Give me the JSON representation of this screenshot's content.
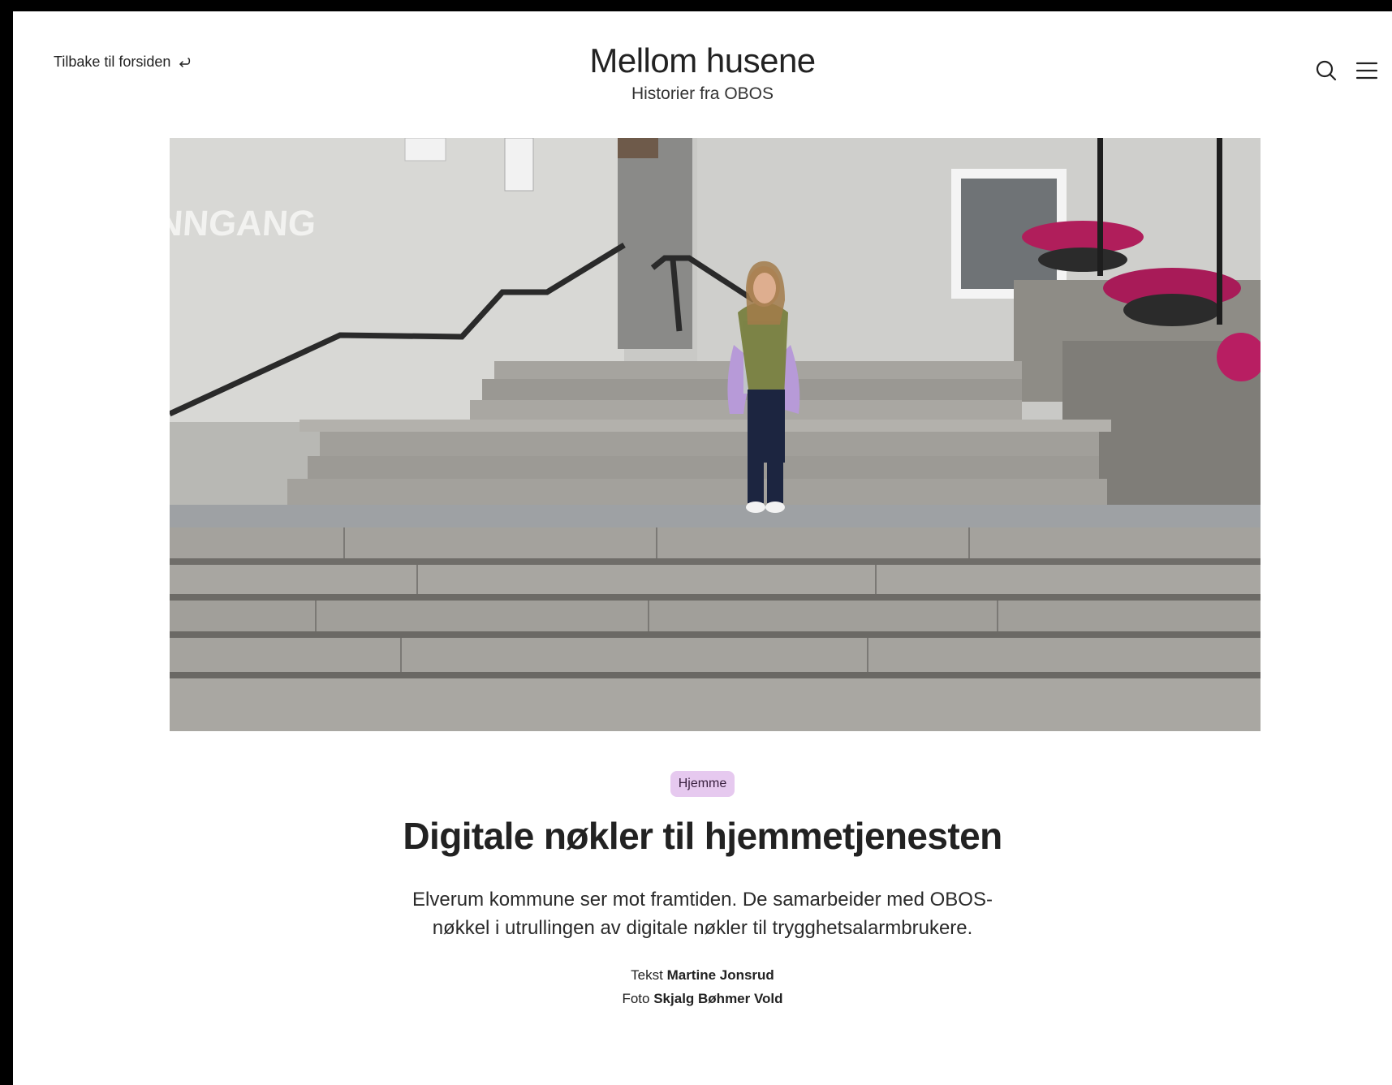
{
  "header": {
    "back_label": "Tilbake til forsiden",
    "site_title": "Mellom husene",
    "site_subtitle": "Historier fra OBOS",
    "search_icon": "search-icon",
    "menu_icon": "hamburger-menu-icon"
  },
  "hero_image": {
    "subject": "Woman walking down wide stone steps in front of a grey building",
    "wall_lettering": "NNGANG"
  },
  "article": {
    "tag": "Hjemme",
    "tag_color": "#e6c9ef",
    "title": "Digitale nøkler til hjemmetjenesten",
    "lead": "Elverum kommune ser mot framtiden. De samarbeider med OBOS-nøkkel i utrullingen av digitale nøkler til trygghetsalarmbrukere.",
    "credits": {
      "text_label": "Tekst",
      "text_author": "Martine Jonsrud",
      "photo_label": "Foto",
      "photo_author": "Skjalg Bøhmer Vold"
    }
  }
}
